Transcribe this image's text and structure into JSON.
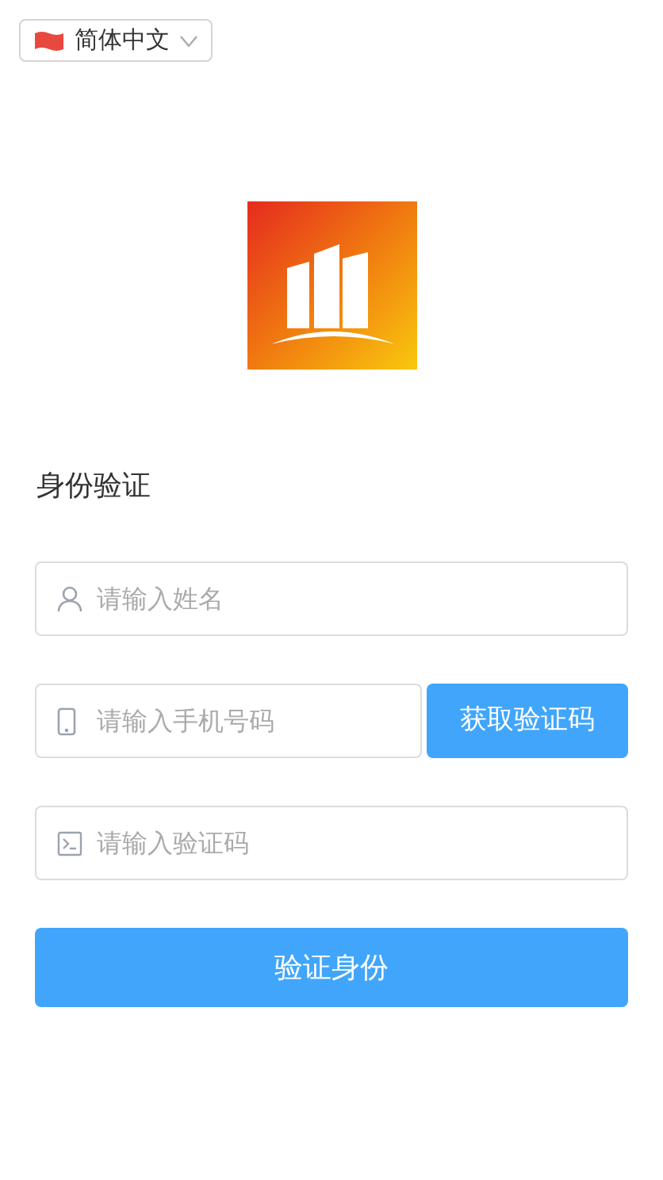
{
  "language_selector": {
    "label": "简体中文"
  },
  "title": "身份验证",
  "fields": [
    {
      "kind": "name",
      "placeholder": "请输入姓名"
    },
    {
      "kind": "phone",
      "placeholder": "请输入手机号码",
      "button": "获取验证码"
    },
    {
      "kind": "code",
      "placeholder": "请输入验证码"
    }
  ],
  "submit_button": "验证身份"
}
